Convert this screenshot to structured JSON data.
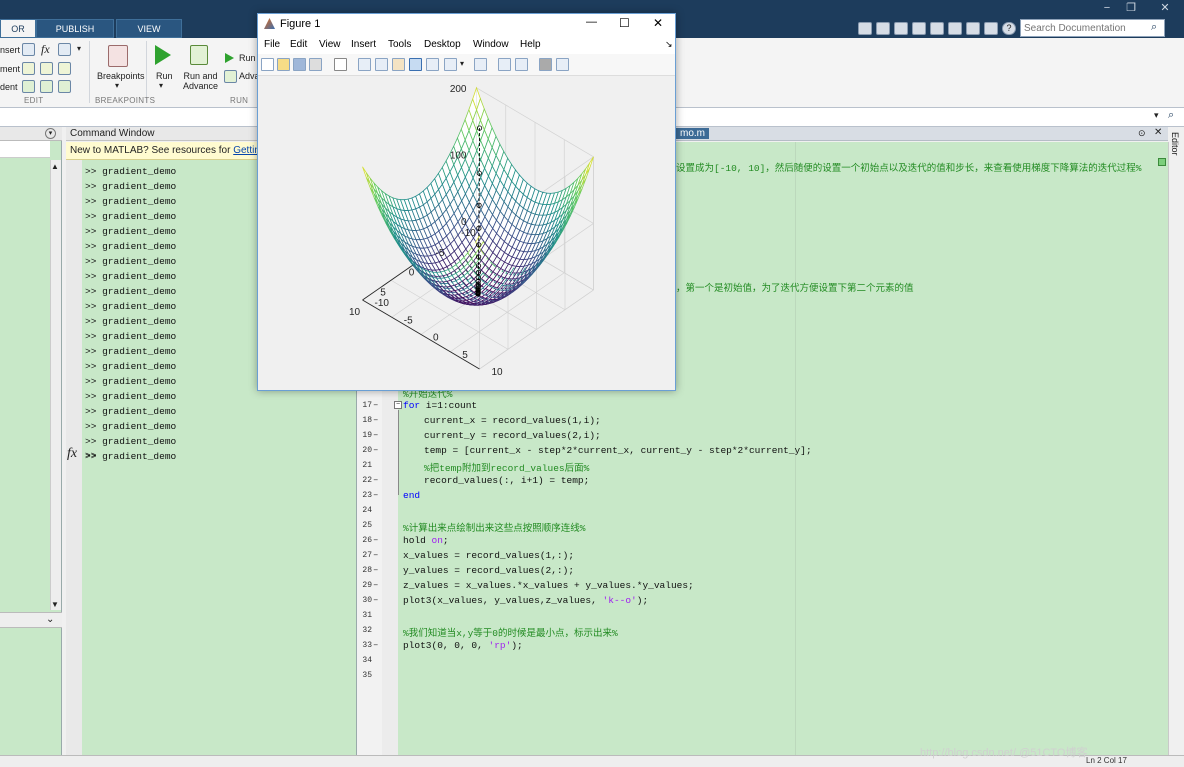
{
  "window": {
    "tabs": [
      "OR",
      "PUBLISH",
      "VIEW"
    ],
    "search_placeholder": "Search Documentation",
    "controls": {
      "minimize": "−",
      "restore": "❐",
      "close": "✕"
    }
  },
  "ribbon": {
    "edit_items": [
      "nsert",
      "ment",
      "dent"
    ],
    "fx_glyph": "fx",
    "breakpoints_label": "Breakpoints",
    "run_label": "Run",
    "run_advance_label": "Run and\nAdvance",
    "run_small": "Run",
    "advance_small": "Adva",
    "groups": [
      "EDIT",
      "BREAKPOINTS",
      "RUN"
    ]
  },
  "command_window": {
    "title": "Command Window",
    "notice_text": "New to MATLAB? See resources for ",
    "notice_link": "Gettin",
    "history": [
      ">> gradient_demo",
      ">> gradient_demo",
      ">> gradient_demo",
      ">> gradient_demo",
      ">> gradient_demo",
      ">> gradient_demo",
      ">> gradient_demo",
      ">> gradient_demo",
      ">> gradient_demo",
      ">> gradient_demo",
      ">> gradient_demo",
      ">> gradient_demo",
      ">> gradient_demo",
      ">> gradient_demo",
      ">> gradient_demo",
      ">> gradient_demo",
      ">> gradient_demo",
      ">> gradient_demo",
      ">> gradient_demo",
      ">> gradient_demo"
    ],
    "prompt": "fx",
    "prompt_symbol": ">>"
  },
  "editor": {
    "tab_fragment": "mo.m",
    "side_label": "Editor",
    "top_comment_fragment": "设置成为[-10, 10]，然后随便的设置一个初始点以及迭代的值和步长，来查看使用梯度下降算法的迭代过程%",
    "mid_comment_fragment": "，第一个是初始值，为了迭代方便设置下第二个元素的值",
    "lines": [
      {
        "n": "17",
        "d": "–",
        "parts": [
          {
            "t": "for",
            "c": "kw"
          },
          {
            "t": " i=1:count",
            "c": ""
          }
        ],
        "indent": 0
      },
      {
        "n": "18",
        "d": "–",
        "parts": [
          {
            "t": "current_x = record_values(1,i);",
            "c": ""
          }
        ],
        "indent": 1
      },
      {
        "n": "19",
        "d": "–",
        "parts": [
          {
            "t": "current_y = record_values(2,i);",
            "c": ""
          }
        ],
        "indent": 1
      },
      {
        "n": "20",
        "d": "–",
        "parts": [
          {
            "t": "temp = [current_x - step*2*current_x, current_y - step*2*current_y];",
            "c": ""
          }
        ],
        "indent": 1
      },
      {
        "n": "21",
        "d": "",
        "parts": [
          {
            "t": "%把temp附加到record_values后面%",
            "c": "cm"
          }
        ],
        "indent": 1
      },
      {
        "n": "22",
        "d": "–",
        "parts": [
          {
            "t": "record_values(:, i+1) = temp;",
            "c": ""
          }
        ],
        "indent": 1
      },
      {
        "n": "23",
        "d": "–",
        "parts": [
          {
            "t": "end",
            "c": "kw"
          }
        ],
        "indent": 0
      },
      {
        "n": "24",
        "d": "",
        "parts": [],
        "indent": 0
      },
      {
        "n": "25",
        "d": "",
        "parts": [
          {
            "t": "%计算出来点绘制出来这些点按照顺序连线%",
            "c": "cm"
          }
        ],
        "indent": 0
      },
      {
        "n": "26",
        "d": "–",
        "parts": [
          {
            "t": "hold ",
            "c": ""
          },
          {
            "t": "on",
            "c": "str"
          },
          {
            "t": ";",
            "c": ""
          }
        ],
        "indent": 0
      },
      {
        "n": "27",
        "d": "–",
        "parts": [
          {
            "t": "x_values = record_values(1,:);",
            "c": ""
          }
        ],
        "indent": 0
      },
      {
        "n": "28",
        "d": "–",
        "parts": [
          {
            "t": "y_values = record_values(2,:);",
            "c": ""
          }
        ],
        "indent": 0
      },
      {
        "n": "29",
        "d": "–",
        "parts": [
          {
            "t": "z_values = x_values.*x_values + y_values.*y_values;",
            "c": ""
          }
        ],
        "indent": 0
      },
      {
        "n": "30",
        "d": "–",
        "parts": [
          {
            "t": "plot3(x_values, y_values,z_values, ",
            "c": ""
          },
          {
            "t": "'k--o'",
            "c": "str"
          },
          {
            "t": ");",
            "c": ""
          }
        ],
        "indent": 0
      },
      {
        "n": "31",
        "d": "",
        "parts": [],
        "indent": 0
      },
      {
        "n": "32",
        "d": "",
        "parts": [
          {
            "t": "%我们知道当x,y等于0的时候是最小点，标示出来%",
            "c": "cm"
          }
        ],
        "indent": 0
      },
      {
        "n": "33",
        "d": "–",
        "parts": [
          {
            "t": "plot3(0, 0, 0, ",
            "c": ""
          },
          {
            "t": "'rp'",
            "c": "str"
          },
          {
            "t": ");",
            "c": ""
          }
        ],
        "indent": 0
      },
      {
        "n": "34",
        "d": "",
        "parts": [],
        "indent": 0
      },
      {
        "n": "35",
        "d": "",
        "parts": [],
        "indent": 0
      }
    ],
    "partial_line16": "%开始迭代%"
  },
  "figure": {
    "title": "Figure 1",
    "menu": [
      "File",
      "Edit",
      "View",
      "Insert",
      "Tools",
      "Desktop",
      "Window",
      "Help"
    ],
    "win_controls": {
      "min": "—",
      "max": "☐",
      "close": "✕"
    },
    "dock_arrow": "↘",
    "z_ticks": [
      "200",
      "100",
      "0"
    ],
    "x_ticks": [
      "-10",
      "-5",
      "0",
      "5",
      "10"
    ],
    "y_ticks": [
      "10",
      "5",
      "0",
      "-5",
      "-10"
    ]
  },
  "statusbar": {
    "fragment": "Ln 2  Col 17"
  },
  "watermark": "http://blog.csdn.net/ @51CTO博客"
}
